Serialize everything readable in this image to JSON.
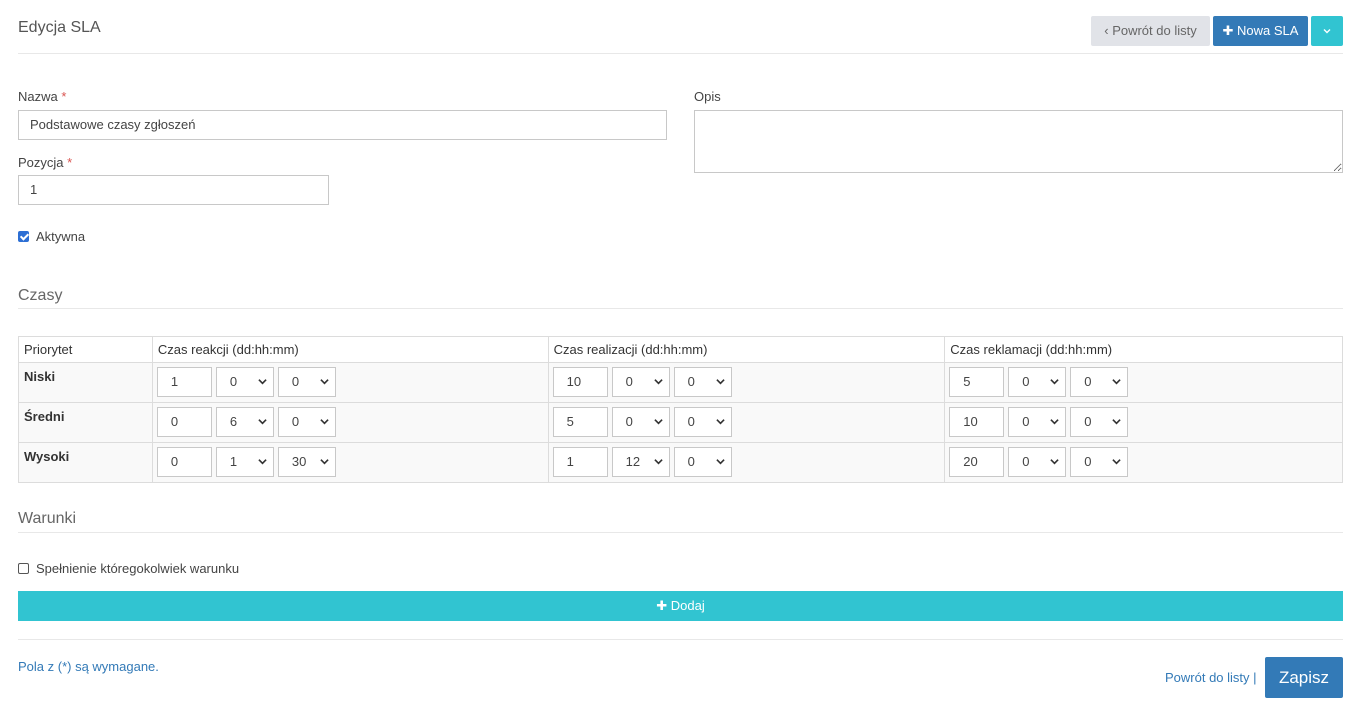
{
  "header": {
    "title": "Edycja SLA",
    "back_label": "‹ Powrót do listy",
    "new_label": "✚ Nowa SLA",
    "dropdown_icon": "chevron-down-icon"
  },
  "form": {
    "name_label": "Nazwa",
    "name_value": "Podstawowe czasy zgłoszeń",
    "position_label": "Pozycja",
    "position_value": "1",
    "description_label": "Opis",
    "description_value": "",
    "active_label": "Aktywna",
    "active_checked": true,
    "required_mark": "*"
  },
  "times": {
    "section_title": "Czasy",
    "headers": [
      "Priorytet",
      "Czas reakcji (dd:hh:mm)",
      "Czas realizacji (dd:hh:mm)",
      "Czas reklamacji (dd:hh:mm)"
    ],
    "rows": [
      {
        "priority": "Niski",
        "reaction": [
          "1",
          "0",
          "0"
        ],
        "realization": [
          "10",
          "0",
          "0"
        ],
        "complaint": [
          "5",
          "0",
          "0"
        ]
      },
      {
        "priority": "Średni",
        "reaction": [
          "0",
          "6",
          "0"
        ],
        "realization": [
          "5",
          "0",
          "0"
        ],
        "complaint": [
          "10",
          "0",
          "0"
        ]
      },
      {
        "priority": "Wysoki",
        "reaction": [
          "0",
          "1",
          "30"
        ],
        "realization": [
          "1",
          "12",
          "0"
        ],
        "complaint": [
          "20",
          "0",
          "0"
        ]
      }
    ]
  },
  "conditions": {
    "section_title": "Warunki",
    "any_condition_label": "Spełnienie któregokolwiek warunku",
    "any_condition_checked": false,
    "add_label": "✚ Dodaj"
  },
  "footer": {
    "required_note": "Pola z (*) są wymagane.",
    "back_link": "Powrót do listy |",
    "save_label": "Zapisz"
  },
  "colors": {
    "primary": "#337ab7",
    "accent": "#31c4d1",
    "required": "#d9534f",
    "back_button_bg": "#e1e3e8"
  }
}
